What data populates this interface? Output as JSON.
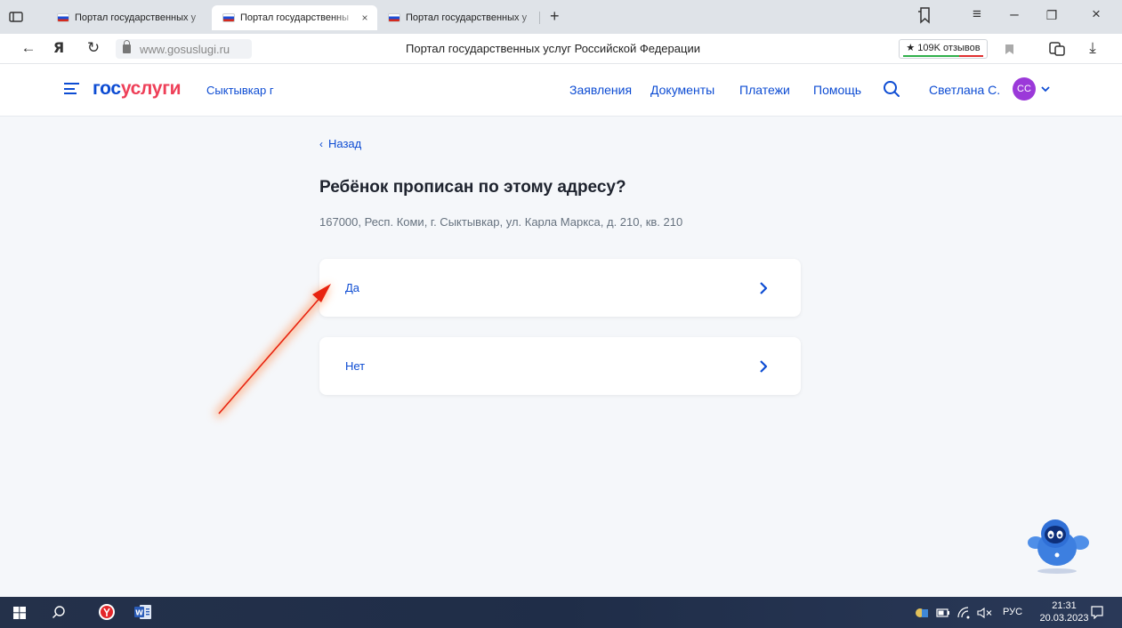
{
  "browser": {
    "tabs": [
      {
        "title": "Портал государственных у",
        "active": false
      },
      {
        "title": "Портал государственны",
        "active": true
      },
      {
        "title": "Портал государственных у",
        "active": false
      }
    ],
    "tab_close": "×",
    "new_tab": "+",
    "url": "www.gosuslugi.ru",
    "page_heading": "Портал государственных услуг Российской Федерации",
    "reviews": "★ 109K отзывов",
    "nav_back": "←",
    "nav_ya": "Я",
    "nav_reload": "↻",
    "win_controls": {
      "minimize": "–",
      "restore": "❐",
      "close": "×",
      "menu": "≡",
      "collections": "⎘"
    },
    "download": "⤓"
  },
  "site": {
    "logo_part1": "гос",
    "logo_part2": "услуги",
    "city": "Сыктывкар г",
    "nav": [
      "Заявления",
      "Документы",
      "Платежи",
      "Помощь"
    ],
    "user_name": "Светлана С.",
    "avatar_initials": "CC"
  },
  "content": {
    "back_label": "Назад",
    "back_chevron": "‹",
    "question": "Ребёнок прописан по этому адресу?",
    "address": "167000, Респ. Коми, г. Сыктывкар, ул. Карла Маркса, д. 210, кв. 210",
    "options": [
      {
        "label": "Да"
      },
      {
        "label": "Нет"
      }
    ]
  },
  "taskbar": {
    "lang": "РУС",
    "time": "21:31",
    "date": "20.03.2023"
  },
  "colors": {
    "brand_blue": "#0d4cd3",
    "brand_red": "#ee3f58",
    "avatar": "#9b39d9",
    "arrow": "#e8230f"
  }
}
